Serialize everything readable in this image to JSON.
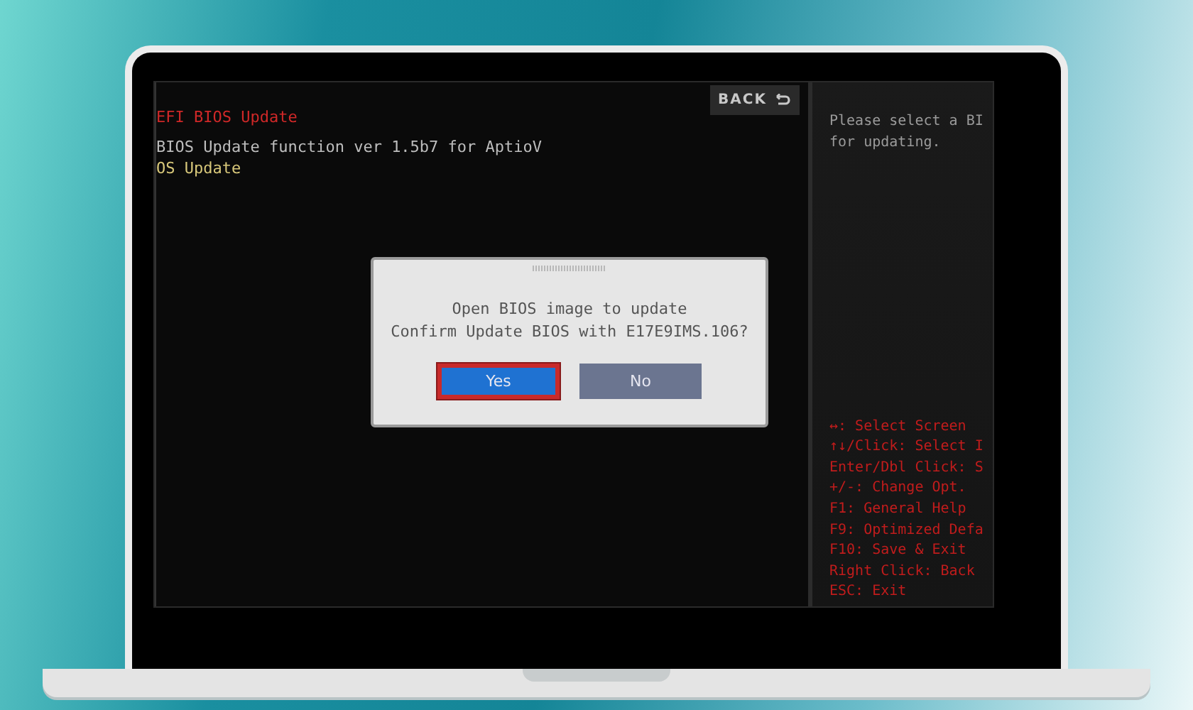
{
  "screen": {
    "back_button": {
      "label": "BACK"
    },
    "log_lines": [
      {
        "text": "EFI BIOS Update",
        "kind": "title"
      },
      {
        "text": "BIOS Update function ver 1.5b7 for AptioV",
        "kind": "info"
      },
      {
        "text": "OS Update",
        "kind": "status"
      }
    ],
    "help_panel": {
      "description": [
        "Please select a BI",
        "for updating."
      ],
      "keys": [
        "↔: Select Screen",
        "↑↓/Click: Select I",
        "Enter/Dbl Click: S",
        "+/-: Change Opt.",
        "F1: General Help",
        "F9: Optimized Defa",
        "F10: Save & Exit",
        "Right Click: Back",
        "ESC: Exit"
      ]
    }
  },
  "dialog": {
    "message": [
      "Open BIOS image to update",
      "Confirm Update BIOS with E17E9IMS.106?"
    ],
    "buttons": [
      {
        "label": "Yes",
        "selected": true
      },
      {
        "label": "No",
        "selected": false
      }
    ]
  }
}
